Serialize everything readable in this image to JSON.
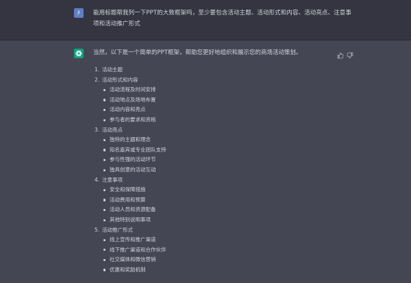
{
  "user_message": {
    "avatar_initials": "JI",
    "text": "能用标题帮我列一下PPT的大致框架吗，至少要包含活动主题、活动形式和内容、活动亮点、注意事项和活动推广形式"
  },
  "assistant_message": {
    "intro": "当然，以下是一个简单的PPT框架，帮助您更好地组织和展示您的商场活动策划。",
    "outline": [
      {
        "number": "1.",
        "title": "活动主题",
        "items": []
      },
      {
        "number": "2.",
        "title": "活动形式和内容",
        "items": [
          "活动流程及时间安排",
          "活动地点及场地布置",
          "活动内容和亮点",
          "参与者的要求和资格"
        ]
      },
      {
        "number": "3.",
        "title": "活动亮点",
        "items": [
          "独特的主题和理念",
          "知名嘉宾或专业团队支持",
          "参与性强的活动环节",
          "独具创意的活动互动"
        ]
      },
      {
        "number": "4.",
        "title": "注意事项",
        "items": [
          "安全和保障措施",
          "活动费用和预算",
          "活动人员和资源配备",
          "其他特别说明事项"
        ]
      },
      {
        "number": "5.",
        "title": "活动推广形式",
        "items": [
          "线上宣传和推广渠道",
          "线下推广渠道和合作伙伴",
          "社交媒体和微信营销",
          "优惠和奖励机制"
        ]
      }
    ]
  },
  "icons": {
    "assistant_avatar": "openai-logo-icon",
    "like": "thumbs-up-icon",
    "dislike": "thumbs-down-icon"
  },
  "colors": {
    "user_bg": "#343541",
    "assistant_bg": "#444654",
    "text": "#d1d5db",
    "user_avatar": "#5d7fc4",
    "assistant_avatar": "#10a37f"
  }
}
